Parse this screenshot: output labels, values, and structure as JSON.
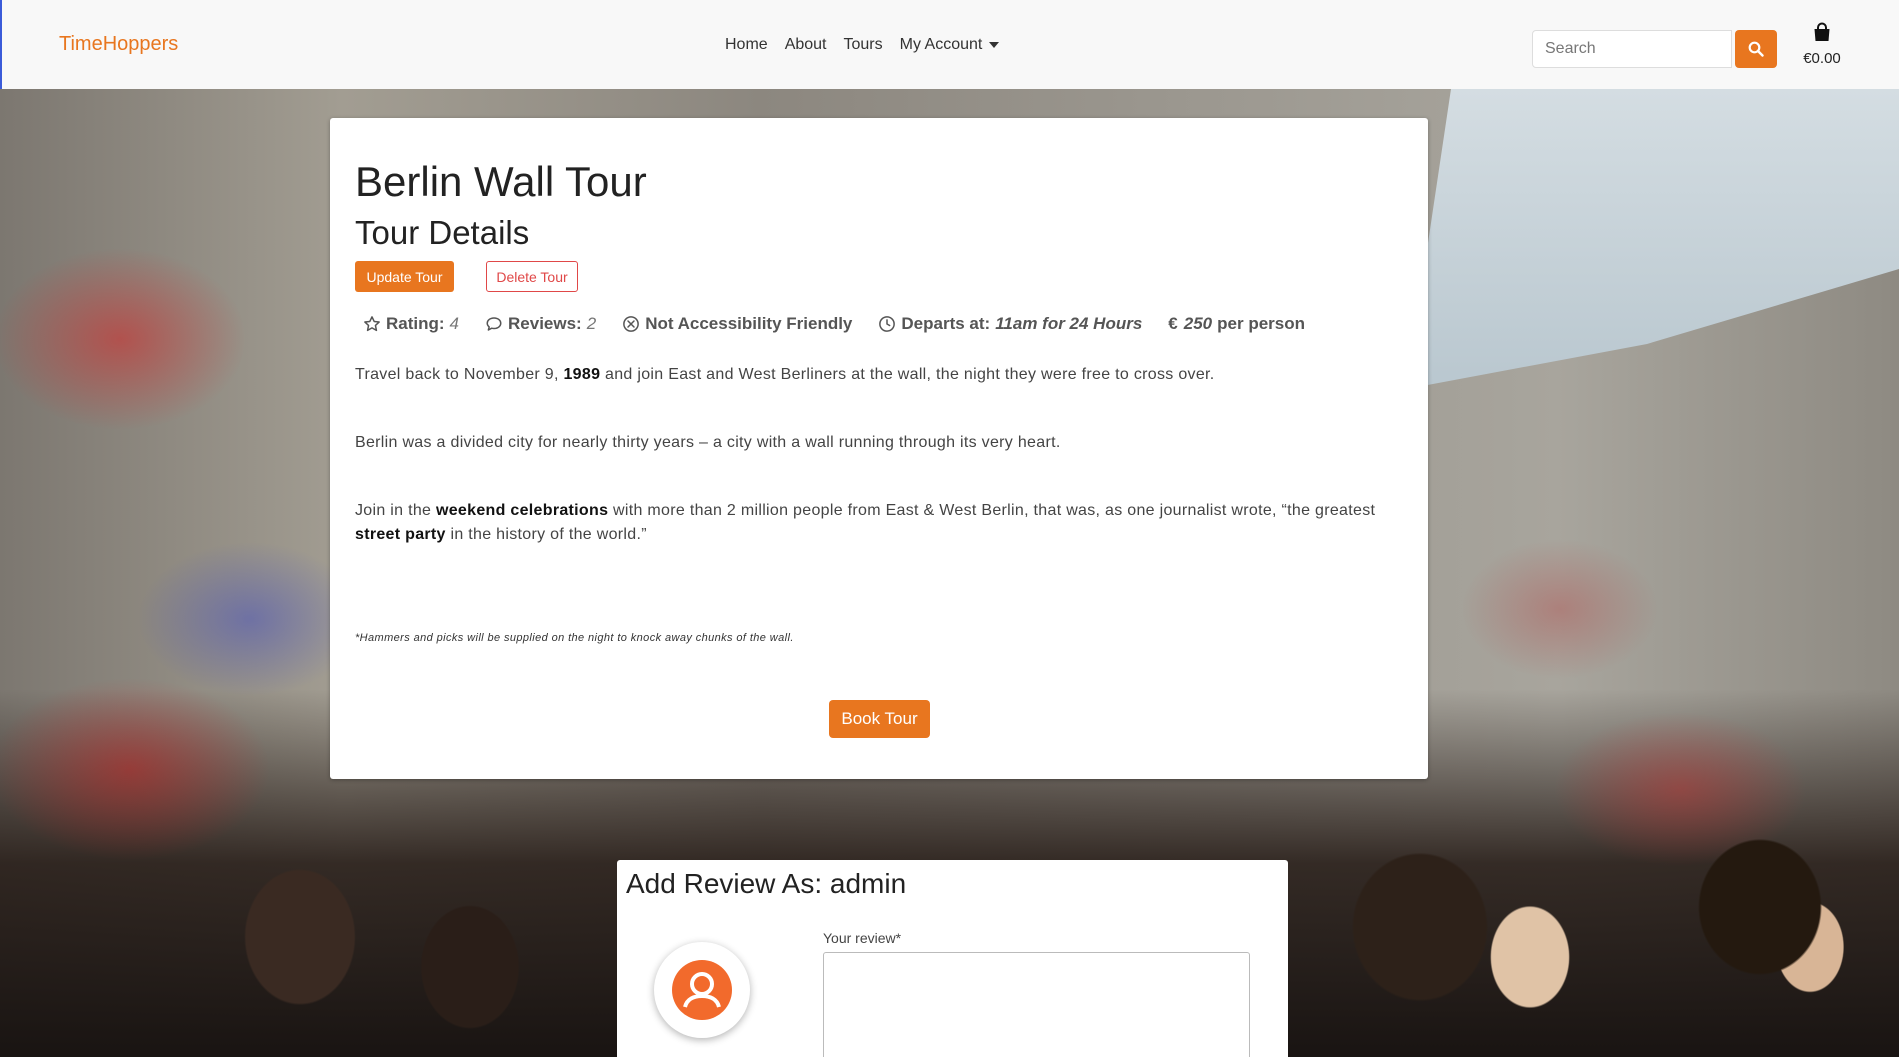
{
  "navbar": {
    "brand": "TimeHoppers",
    "links": [
      "Home",
      "About",
      "Tours",
      "My Account"
    ],
    "search_placeholder": "Search",
    "cart_total": "€0.00",
    "accent_color": "#e8761f"
  },
  "tour": {
    "title": "Berlin Wall Tour",
    "subtitle": "Tour Details",
    "update_label": "Update Tour",
    "delete_label": "Delete Tour",
    "meta": {
      "rating_label": "Rating:",
      "rating_value": "4",
      "reviews_label": "Reviews:",
      "reviews_value": "2",
      "accessibility": "Not Accessibility Friendly",
      "departs_label": "Departs at:",
      "departs_value": "11am for 24 Hours",
      "price_currency": "€",
      "price_value": "250",
      "price_unit": "per person"
    },
    "para1": {
      "a": "Travel back to November 9, ",
      "b": "1989",
      "c": " and join East and West Berliners at the wall, the night they were free to cross over."
    },
    "para2": "Berlin was a divided city for nearly thirty years – a city with a wall running through its very heart.",
    "para3": {
      "a": "Join in the ",
      "b": "weekend celebrations",
      "c": " with more than 2 million people from East & West Berlin, that was, as one journalist wrote, “the greatest ",
      "d": "street party",
      "e": " in the history of the world.”"
    },
    "footnote": "*Hammers and picks will be supplied on the night to knock away chunks of the wall.",
    "book_label": "Book Tour"
  },
  "review": {
    "title": "Add Review As: admin",
    "field_label": "Your review*"
  }
}
